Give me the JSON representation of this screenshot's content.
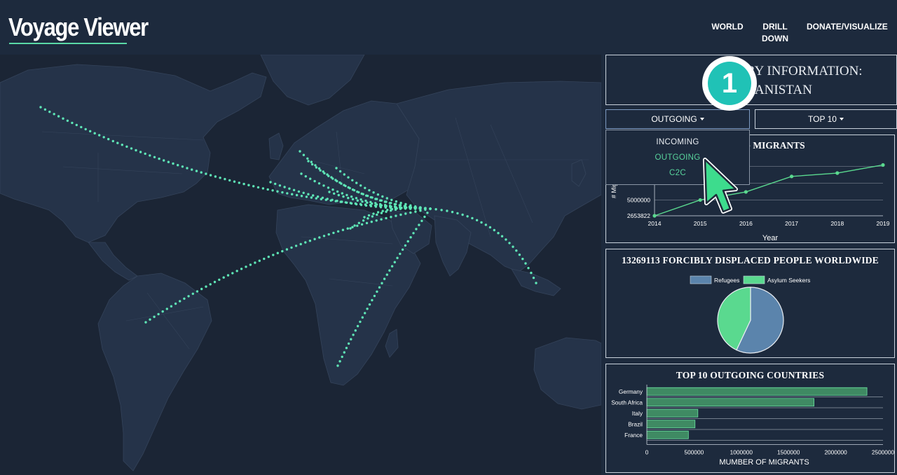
{
  "app": {
    "logo": "Voyage Viewer"
  },
  "nav": {
    "world": "WORLD",
    "drill_down": "DRILL DOWN",
    "donate": "DONATE/VISUALIZE"
  },
  "info": {
    "title_line1": "TRY INFORMATION:",
    "title_line2": "AFGHANISTAN"
  },
  "controls": {
    "direction_label": "OUTGOING",
    "top_label": "TOP 10",
    "dropdown_options": [
      "INCOMING",
      "OUTGOING",
      "C2C"
    ]
  },
  "step_badge": "1",
  "colors": {
    "accent": "#5ad9a6",
    "panel_bg": "#1d2a3d",
    "map_land": "#26344a",
    "arc": "#5ee6b6",
    "refugees": "#5b84ac",
    "asylum": "#5ad98f"
  },
  "chart_data": [
    {
      "type": "line",
      "title": "OUTGOING MIGRANTS",
      "title_visible": "OING MIGRANTS",
      "xlabel": "Year",
      "ylabel": "# Mig",
      "x": [
        2014,
        2015,
        2016,
        2017,
        2018,
        2019
      ],
      "values": [
        2653822,
        5000000,
        6200000,
        8500000,
        9000000,
        10200000
      ],
      "y_ticks": [
        "2653822",
        "5000000"
      ],
      "x_ticks": [
        "2014",
        "2015",
        "2016",
        "2017",
        "2018",
        "2019"
      ],
      "ylim": [
        2653822,
        11500000
      ]
    },
    {
      "type": "pie",
      "title": "13269113 FORCIBLY DISPLACED PEOPLE WORLDWIDE",
      "legend": [
        "Refugees",
        "Asylum Seekers"
      ],
      "values": [
        57,
        43
      ]
    },
    {
      "type": "bar",
      "orientation": "horizontal",
      "title": "TOP 10 OUTGOING COUNTRIES",
      "xlabel": "MUMBER OF MIGRANTS",
      "categories": [
        "Germany",
        "South Africa",
        "Italy",
        "Brazil",
        "France"
      ],
      "values": [
        2330000,
        1770000,
        540000,
        510000,
        440000
      ],
      "x_ticks": [
        "0",
        "500000",
        "1000000",
        "1500000",
        "2000000",
        "2500000"
      ],
      "xlim": [
        0,
        2500000
      ]
    }
  ]
}
